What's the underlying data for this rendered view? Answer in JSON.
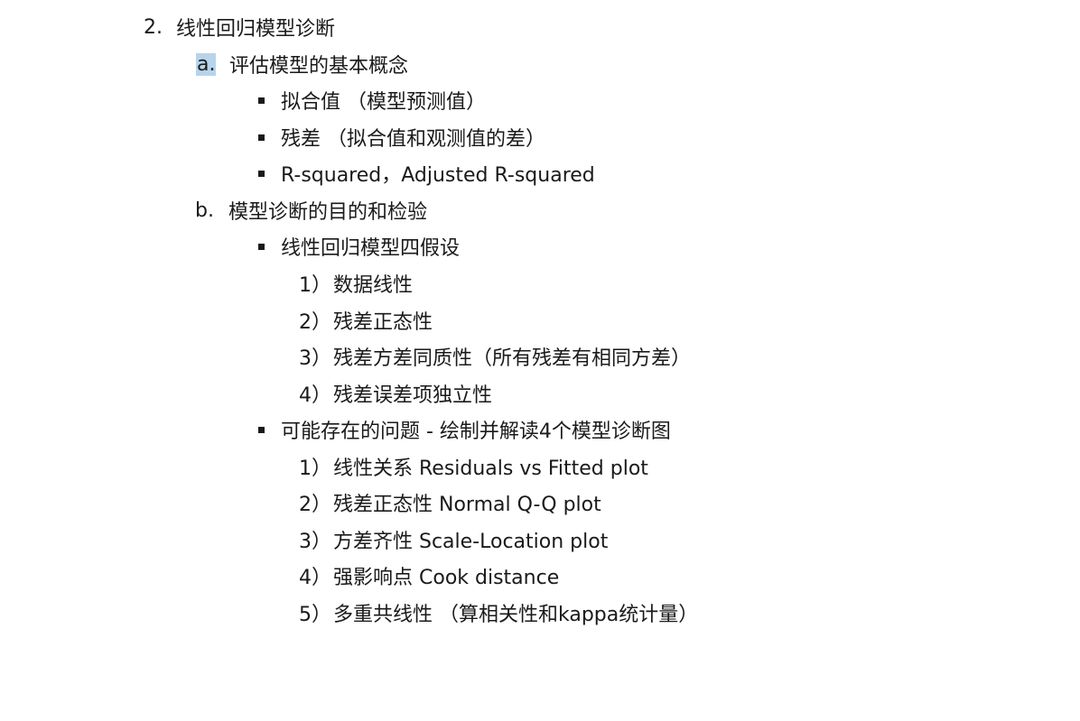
{
  "section": {
    "number": "2.",
    "title": "线性回归模型诊断"
  },
  "sub_a": {
    "marker": "a.",
    "title": "评估模型的基本概念",
    "bullets": [
      "拟合值 （模型预测值）",
      "残差 （拟合值和观测值的差）",
      "R-squared，Adjusted R-squared"
    ]
  },
  "sub_b": {
    "marker": "b.",
    "title": "模型诊断的目的和检验",
    "bullet1": {
      "text": "线性回归模型四假设",
      "items": [
        {
          "num": "1）",
          "text": "数据线性"
        },
        {
          "num": "2）",
          "text": "残差正态性"
        },
        {
          "num": "3）",
          "text": "残差方差同质性（所有残差有相同方差）"
        },
        {
          "num": "4）",
          "text": "残差误差项独立性"
        }
      ]
    },
    "bullet2": {
      "text": "可能存在的问题 - 绘制并解读4个模型诊断图",
      "items": [
        {
          "num": "1）",
          "text": "线性关系 Residuals vs Fitted plot"
        },
        {
          "num": "2）",
          "text": "残差正态性 Normal Q-Q plot"
        },
        {
          "num": "3）",
          "text": "方差齐性 Scale-Location plot"
        },
        {
          "num": "4）",
          "text": "强影响点 Cook distance"
        },
        {
          "num": "5）",
          "text": "多重共线性 （算相关性和kappa统计量）"
        }
      ]
    }
  }
}
